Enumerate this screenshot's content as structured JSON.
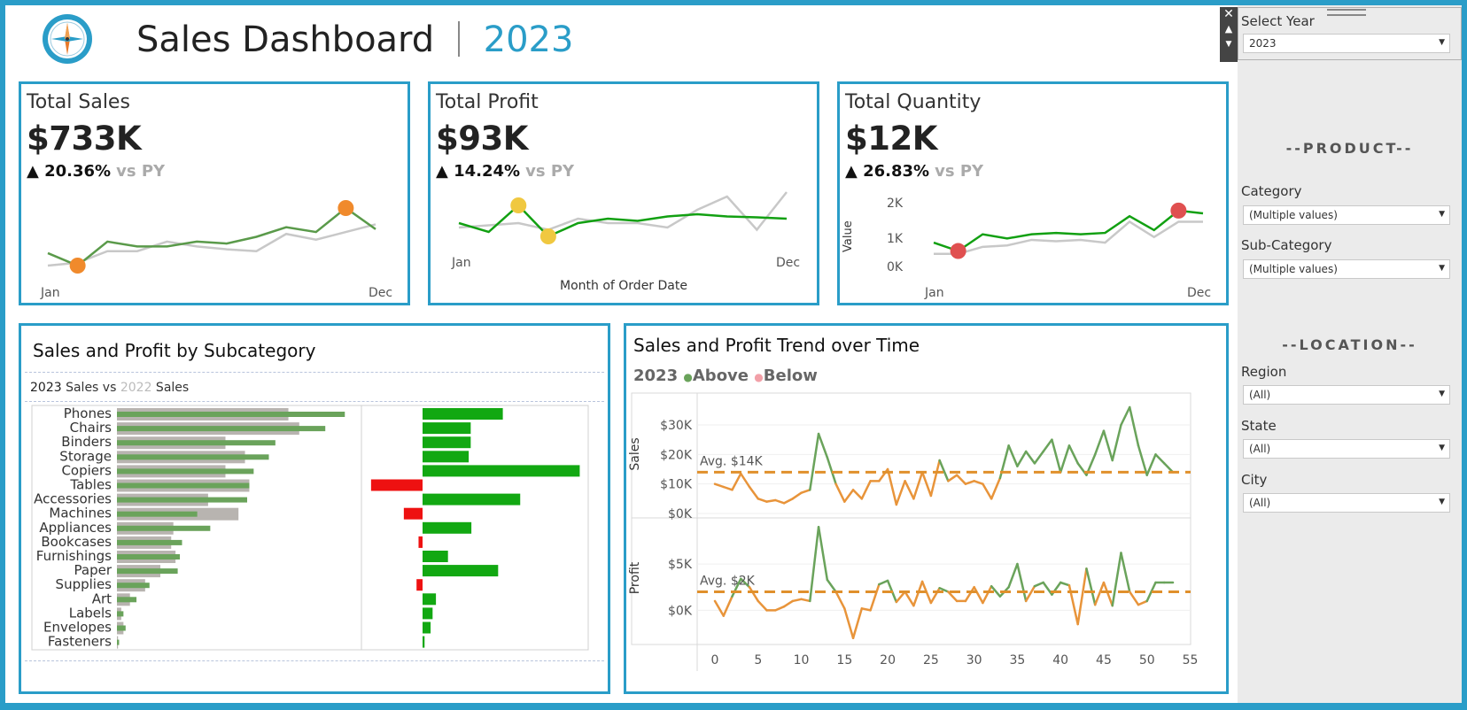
{
  "header": {
    "title": "Sales Dashboard",
    "year": "2023"
  },
  "kpis": [
    {
      "title": "Total Sales",
      "value": "$733K",
      "delta_icon": "triangle-up-icon",
      "delta": "20.36%",
      "vs": "vs PY",
      "x_start": "Jan",
      "x_end": "Dec"
    },
    {
      "title": "Total Profit",
      "value": "$93K",
      "delta_icon": "triangle-up-icon",
      "delta": "14.24%",
      "vs": "vs PY",
      "x_start": "Jan",
      "x_end": "Dec",
      "x_axis_label": "Month of Order Date"
    },
    {
      "title": "Total Quantity",
      "value": "$12K",
      "delta_icon": "triangle-up-icon",
      "delta": "26.83%",
      "vs": "vs PY",
      "x_start": "Jan",
      "x_end": "Dec",
      "y_axis_label": "Value",
      "y_ticks": [
        "2K",
        "1K",
        "0K"
      ]
    }
  ],
  "subcategory_panel": {
    "title": "Sales and Profit by Subcategory",
    "legend": {
      "current": "2023",
      "mid": " Sales vs ",
      "previous": "2022",
      "tail": " Sales"
    }
  },
  "trend_panel": {
    "title": "Sales and Profit Trend over Time",
    "legend": {
      "year": "2023",
      "above": "Above",
      "below": "Below"
    },
    "sales_axis_label": "Sales",
    "profit_axis_label": "Profit",
    "sales_avg_label": "Avg. $14K",
    "profit_avg_label": "Avg. $2K",
    "sales_ticks": [
      "$30K",
      "$20K",
      "$10K",
      "$0K"
    ],
    "profit_ticks": [
      "$5K",
      "$0K"
    ],
    "x_ticks": [
      "0",
      "5",
      "10",
      "15",
      "20",
      "25",
      "30",
      "35",
      "40",
      "45",
      "50",
      "55"
    ]
  },
  "sidebar": {
    "select_year_label": "Select Year",
    "select_year_value": "2023",
    "product_header": "--PRODUCT--",
    "category_label": "Category",
    "category_value": "(Multiple values)",
    "subcategory_label": "Sub-Category",
    "subcategory_value": "(Multiple values)",
    "location_header": "--LOCATION--",
    "region_label": "Region",
    "region_value": "(All)",
    "state_label": "State",
    "state_value": "(All)",
    "city_label": "City",
    "city_value": "(All)"
  },
  "colors": {
    "accent": "#2a9dc8",
    "current_bar": "#6aa35b",
    "previous_bar": "#b8b4b0",
    "positive_profit": "#12a812",
    "negative_profit": "#ee1111",
    "above": "#6aa35b",
    "below": "#e8943a",
    "avg_line": "#e0902c"
  },
  "chart_data": [
    {
      "type": "line",
      "name": "Total Sales sparkline",
      "x": [
        "Jan",
        "Feb",
        "Mar",
        "Apr",
        "May",
        "Jun",
        "Jul",
        "Aug",
        "Sep",
        "Oct",
        "Nov",
        "Dec"
      ],
      "series": [
        {
          "values": [
            48,
            35,
            60,
            55,
            55,
            60,
            58,
            65,
            75,
            70,
            95,
            73
          ]
        },
        {
          "values": [
            35,
            38,
            50,
            50,
            60,
            55,
            52,
            50,
            68,
            62,
            70,
            78
          ]
        }
      ]
    },
    {
      "type": "line",
      "name": "Total Profit sparkline",
      "x": [
        "Jan",
        "Feb",
        "Mar",
        "Apr",
        "May",
        "Jun",
        "Jul",
        "Aug",
        "Sep",
        "Oct",
        "Nov",
        "Dec"
      ],
      "series": [
        {
          "values": [
            7,
            5,
            11,
            4,
            7,
            8,
            7.5,
            8.5,
            9,
            8.5,
            8.3,
            8.0
          ]
        },
        {
          "values": [
            6,
            6.5,
            7,
            5.5,
            8,
            7,
            7,
            6,
            10,
            13,
            5.5,
            14
          ]
        }
      ]
    },
    {
      "type": "line",
      "name": "Total Quantity sparkline",
      "x": [
        "Jan",
        "Feb",
        "Mar",
        "Apr",
        "May",
        "Jun",
        "Jul",
        "Aug",
        "Sep",
        "Oct",
        "Nov",
        "Dec"
      ],
      "y_ticks": [
        "0K",
        "1K",
        "2K"
      ],
      "series": [
        {
          "values": [
            600,
            300,
            900,
            750,
            900,
            950,
            900,
            950,
            1550,
            1050,
            1750,
            1650
          ]
        },
        {
          "values": [
            200,
            200,
            450,
            500,
            700,
            650,
            700,
            600,
            1350,
            800,
            1350,
            1350
          ]
        }
      ]
    },
    {
      "type": "bar",
      "name": "Sales by subcategory",
      "categories": [
        "Phones",
        "Chairs",
        "Binders",
        "Storage",
        "Copiers",
        "Tables",
        "Accessories",
        "Machines",
        "Appliances",
        "Bookcases",
        "Furnishings",
        "Paper",
        "Supplies",
        "Art",
        "Labels",
        "Envelopes",
        "Fasteners"
      ],
      "series": [
        {
          "values": [
            105,
            96,
            73,
            70,
            63,
            61,
            60,
            37,
            43,
            30,
            29,
            28,
            15,
            9,
            3,
            4,
            1
          ]
        },
        {
          "values": [
            79,
            84,
            50,
            59,
            50,
            61,
            42,
            56,
            26,
            25,
            27,
            20,
            13,
            6,
            2,
            3,
            0.5
          ]
        }
      ]
    },
    {
      "type": "bar",
      "name": "Profit by subcategory",
      "categories": [
        "Phones",
        "Chairs",
        "Binders",
        "Storage",
        "Copiers",
        "Tables",
        "Accessories",
        "Machines",
        "Appliances",
        "Bookcases",
        "Furnishings",
        "Paper",
        "Supplies",
        "Art",
        "Labels",
        "Envelopes",
        "Fasteners"
      ],
      "values": [
        12,
        7.2,
        7.2,
        6.9,
        23.5,
        -7.7,
        14.6,
        -2.8,
        7.3,
        -0.6,
        3.8,
        11.3,
        -0.9,
        2.0,
        1.5,
        1.2,
        0.3
      ]
    },
    {
      "type": "line",
      "name": "Weekly sales",
      "x": [
        0,
        1,
        2,
        3,
        4,
        5,
        6,
        7,
        8,
        9,
        10,
        11,
        12,
        13,
        14,
        15,
        16,
        17,
        18,
        19,
        20,
        21,
        22,
        23,
        24,
        25,
        26,
        27,
        28,
        29,
        30,
        31,
        32,
        33,
        34,
        35,
        36,
        37,
        38,
        39,
        40,
        41,
        42,
        43,
        44,
        45,
        46,
        47,
        48,
        49,
        50,
        51,
        52,
        53
      ],
      "values": [
        10,
        9,
        8,
        13.5,
        9,
        5,
        4,
        4.5,
        3.5,
        5,
        7,
        8,
        27,
        19,
        10,
        4,
        8,
        5,
        11,
        11,
        15,
        3,
        11,
        5,
        14,
        6,
        18,
        11,
        13,
        10,
        11,
        10,
        5,
        12,
        23,
        16,
        21,
        17,
        21,
        25,
        14,
        23,
        17,
        13,
        20,
        28,
        18,
        30,
        36,
        23,
        13,
        20,
        17,
        14
      ],
      "avg": 14
    },
    {
      "type": "line",
      "name": "Weekly profit",
      "x": [
        0,
        1,
        2,
        3,
        4,
        5,
        6,
        7,
        8,
        9,
        10,
        11,
        12,
        13,
        14,
        15,
        16,
        17,
        18,
        19,
        20,
        21,
        22,
        23,
        24,
        25,
        26,
        27,
        28,
        29,
        30,
        31,
        32,
        33,
        34,
        35,
        36,
        37,
        38,
        39,
        40,
        41,
        42,
        43,
        44,
        45,
        46,
        47,
        48,
        49,
        50,
        51,
        52,
        53
      ],
      "values": [
        1,
        -0.6,
        1.5,
        3.4,
        2.5,
        1,
        0,
        0,
        0.4,
        1,
        1.2,
        1,
        9,
        3.3,
        2,
        0.2,
        -3,
        0.2,
        0,
        2.8,
        3.2,
        0.9,
        2,
        0.5,
        3.1,
        0.8,
        2.4,
        2,
        1,
        1,
        2.5,
        0.8,
        2.6,
        1.5,
        2.5,
        5,
        1,
        2.6,
        3,
        1.7,
        3,
        2.7,
        -1.5,
        4.5,
        0.6,
        3,
        0.5,
        6.2,
        2,
        0.6,
        1,
        3,
        3,
        3
      ],
      "avg": 2
    }
  ]
}
